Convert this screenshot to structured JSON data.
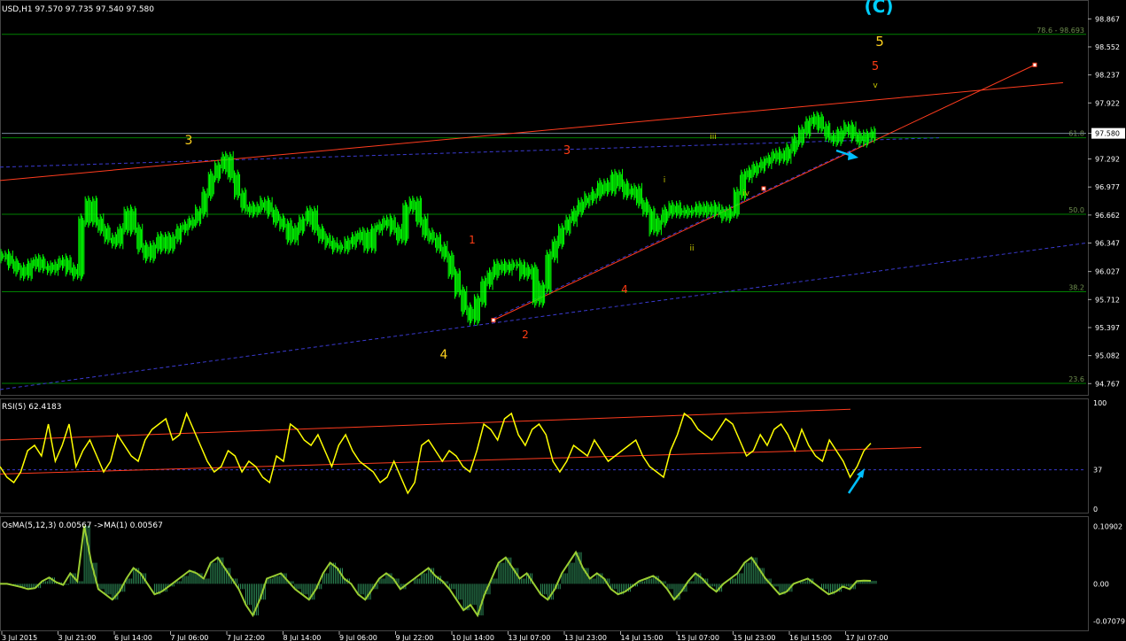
{
  "window": {
    "main_title": "USD,H1  97.570 97.735 97.540 97.580",
    "rsi_title": "RSI(5) 62.4183",
    "osma_title": "OsMA(5,12,3) 0.00567  ->MA(1) 0.00567"
  },
  "colors": {
    "background": "#000000",
    "candles": "#00ff00",
    "grid_hline": "#008000",
    "trendline": "#ff3c1e",
    "dashed": "#3a3acf",
    "rsi_line": "#ffff00",
    "osma_line": "#9acd32",
    "osma_hist": "#2e8b57",
    "arrow": "#00bfff",
    "wave_yellow": "#ffd21e",
    "wave_red": "#ff3c14",
    "axis_text": "#ffffff"
  },
  "chart_data": [
    {
      "type": "candlestick",
      "symbol": "USD",
      "timeframe": "H1",
      "last_price": "97.580",
      "y_axis_ticks": [
        "98.867",
        "98.552",
        "98.237",
        "97.922",
        "97.580",
        "97.292",
        "96.977",
        "96.662",
        "96.347",
        "96.027",
        "95.712",
        "95.397",
        "95.082",
        "94.767"
      ],
      "ylim": [
        94.7,
        98.9
      ],
      "fib_levels": [
        {
          "label": "78.6 - 98.693",
          "value": 98.693
        },
        {
          "label": "61.8",
          "value": 97.53
        },
        {
          "label": "50.0",
          "value": 96.67
        },
        {
          "label": "38.2",
          "value": 95.8
        },
        {
          "label": "23.6",
          "value": 94.77
        }
      ],
      "wave_labels": [
        {
          "text": "(C)",
          "color": "cyan"
        },
        {
          "text": "5",
          "color": "yellow"
        },
        {
          "text": "5",
          "color": "red"
        },
        {
          "text": "v",
          "color": "olive"
        },
        {
          "text": "3",
          "color": "yellow"
        },
        {
          "text": "3",
          "color": "red"
        },
        {
          "text": "iii",
          "color": "olive"
        },
        {
          "text": "i",
          "color": "olive"
        },
        {
          "text": "iv",
          "color": "olive"
        },
        {
          "text": "1",
          "color": "red"
        },
        {
          "text": "ii",
          "color": "olive"
        },
        {
          "text": "4",
          "color": "red"
        },
        {
          "text": "2",
          "color": "red"
        },
        {
          "text": "4",
          "color": "yellow"
        }
      ],
      "price_series": [
        96.2,
        96.12,
        96.05,
        96.0,
        96.1,
        96.15,
        96.08,
        96.05,
        96.1,
        96.15,
        96.05,
        96.0,
        96.6,
        96.8,
        96.6,
        96.5,
        96.4,
        96.35,
        96.5,
        96.7,
        96.5,
        96.3,
        96.2,
        96.3,
        96.4,
        96.3,
        96.4,
        96.5,
        96.55,
        96.6,
        96.7,
        96.9,
        97.1,
        97.2,
        97.3,
        97.1,
        96.9,
        96.75,
        96.7,
        96.75,
        96.8,
        96.7,
        96.6,
        96.55,
        96.4,
        96.5,
        96.6,
        96.7,
        96.5,
        96.4,
        96.35,
        96.3,
        96.3,
        96.35,
        96.4,
        96.45,
        96.3,
        96.5,
        96.55,
        96.6,
        96.5,
        96.4,
        96.75,
        96.8,
        96.6,
        96.45,
        96.4,
        96.3,
        96.2,
        96.0,
        95.8,
        95.6,
        95.5,
        95.7,
        95.9,
        96.0,
        96.1,
        96.05,
        96.1,
        96.1,
        96.0,
        96.05,
        95.7,
        95.85,
        96.2,
        96.35,
        96.5,
        96.6,
        96.7,
        96.8,
        96.85,
        96.9,
        97.0,
        96.95,
        97.1,
        97.0,
        96.9,
        96.95,
        96.8,
        96.7,
        96.5,
        96.6,
        96.7,
        96.75,
        96.7,
        96.7,
        96.7,
        96.75,
        96.7,
        96.75,
        96.7,
        96.65,
        96.7,
        96.9,
        97.1,
        97.15,
        97.2,
        97.25,
        97.3,
        97.35,
        97.3,
        97.4,
        97.5,
        97.6,
        97.7,
        97.75,
        97.65,
        97.55,
        97.5,
        97.6,
        97.65,
        97.55,
        97.5,
        97.55,
        97.58
      ],
      "x_tick_labels": [
        "3 Jul 2015",
        "3 Jul 21:00",
        "6 Jul 14:00",
        "7 Jul 06:00",
        "7 Jul 22:00",
        "8 Jul 14:00",
        "9 Jul 06:00",
        "9 Jul 22:00",
        "10 Jul 14:00",
        "13 Jul 07:00",
        "13 Jul 23:00",
        "14 Jul 15:00",
        "15 Jul 07:00",
        "15 Jul 23:00",
        "16 Jul 15:00",
        "17 Jul 07:00"
      ]
    },
    {
      "type": "line",
      "name": "RSI(5)",
      "y_axis_ticks": [
        "100",
        "37",
        "0"
      ],
      "ylim": [
        0,
        100
      ],
      "reference_level": 37,
      "values": [
        40,
        30,
        25,
        35,
        55,
        60,
        50,
        80,
        45,
        60,
        80,
        40,
        55,
        65,
        50,
        35,
        45,
        70,
        60,
        50,
        45,
        65,
        75,
        80,
        85,
        65,
        70,
        90,
        75,
        60,
        45,
        35,
        40,
        55,
        50,
        35,
        45,
        40,
        30,
        25,
        50,
        45,
        80,
        75,
        65,
        60,
        70,
        55,
        40,
        60,
        70,
        55,
        45,
        40,
        35,
        25,
        30,
        45,
        30,
        15,
        25,
        60,
        65,
        55,
        45,
        55,
        50,
        40,
        35,
        55,
        80,
        75,
        65,
        85,
        90,
        70,
        60,
        75,
        80,
        70,
        45,
        35,
        45,
        60,
        55,
        50,
        65,
        55,
        45,
        50,
        55,
        60,
        65,
        50,
        40,
        35,
        30,
        55,
        70,
        90,
        85,
        75,
        70,
        65,
        75,
        85,
        80,
        65,
        50,
        55,
        70,
        60,
        75,
        80,
        70,
        55,
        75,
        60,
        50,
        45,
        65,
        55,
        45,
        30,
        40,
        55,
        62
      ]
    },
    {
      "type": "bar",
      "name": "OsMA(5,12,3)",
      "y_axis_ticks": [
        "0.10902",
        "0.00",
        "-0.07079"
      ],
      "ylim": [
        -0.085,
        0.12
      ],
      "values": [
        0.0,
        0.0,
        -0.003,
        -0.006,
        -0.01,
        -0.008,
        0.005,
        0.012,
        0.003,
        -0.002,
        0.02,
        0.005,
        0.11,
        0.04,
        -0.01,
        -0.02,
        -0.03,
        -0.015,
        0.01,
        0.03,
        0.02,
        0.0,
        -0.02,
        -0.015,
        -0.005,
        0.005,
        0.015,
        0.025,
        0.02,
        0.01,
        0.04,
        0.05,
        0.03,
        0.01,
        -0.01,
        -0.04,
        -0.06,
        -0.03,
        0.01,
        0.015,
        0.02,
        0.005,
        -0.01,
        -0.02,
        -0.03,
        -0.01,
        0.02,
        0.04,
        0.03,
        0.01,
        0.0,
        -0.02,
        -0.03,
        -0.01,
        0.01,
        0.02,
        0.01,
        -0.01,
        0.0,
        0.01,
        0.02,
        0.03,
        0.015,
        0.005,
        -0.01,
        -0.03,
        -0.05,
        -0.04,
        -0.06,
        -0.02,
        0.01,
        0.04,
        0.05,
        0.03,
        0.01,
        0.02,
        0.0,
        -0.02,
        -0.03,
        -0.01,
        0.02,
        0.04,
        0.06,
        0.03,
        0.01,
        0.02,
        0.01,
        -0.01,
        -0.02,
        -0.015,
        -0.005,
        0.005,
        0.01,
        0.015,
        0.005,
        -0.01,
        -0.03,
        -0.015,
        0.005,
        0.02,
        0.01,
        -0.005,
        -0.015,
        0.0,
        0.01,
        0.02,
        0.04,
        0.05,
        0.03,
        0.01,
        -0.005,
        -0.02,
        -0.015,
        0.0,
        0.005,
        0.01,
        0.0,
        -0.01,
        -0.02,
        -0.015,
        -0.005,
        -0.01,
        0.005,
        0.006,
        0.0057
      ]
    }
  ]
}
